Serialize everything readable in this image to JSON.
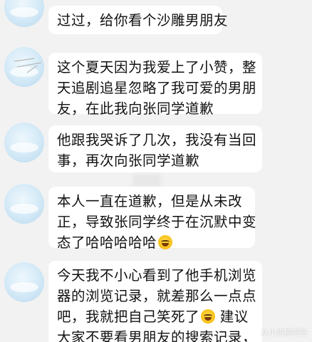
{
  "messages": [
    {
      "lines": [
        "过过，给你看个沙雕男朋友"
      ]
    },
    {
      "lines": [
        "这个夏天因为我爱上了小赞，整",
        "天追剧追星忽略了我可爱的男朋",
        "友，在此我向张同学道歉"
      ]
    },
    {
      "lines": [
        "他跟我哭诉了几次，我没有当回",
        "事，再次向张同学道歉"
      ]
    },
    {
      "lines": [
        "本人一直在道歉，但是从未改",
        "正，导致张同学终于在沉默中变",
        "态了哈哈哈哈哈"
      ],
      "emoji_after_last_line": "laughing-face-icon"
    },
    {
      "lines": [
        "今天我不小心看到了他手机浏览",
        "器的浏览记录，就差那么一点点",
        "吧，我就把自己笑死了",
        "大家不要看男朋友的搜索记录，"
      ],
      "line3_emoji": "laughing-face-icon",
      "line3_suffix": " 建议"
    }
  ],
  "watermark": "从小吉鲸问答",
  "colors": {
    "background": "#f2f2f2",
    "bubble": "#ffffff",
    "text": "#111111",
    "avatar": "#cfe6f5"
  }
}
